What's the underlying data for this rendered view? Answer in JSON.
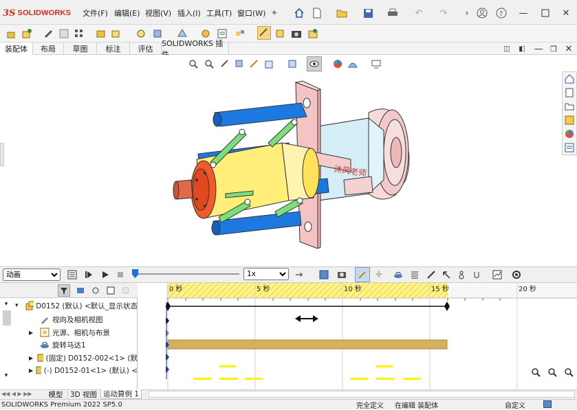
{
  "app": {
    "logo_mark": "3S",
    "logo_text": "SOLIDWORKS"
  },
  "menu": [
    {
      "label": "文件(F)"
    },
    {
      "label": "编辑(E)"
    },
    {
      "label": "视图(V)"
    },
    {
      "label": "插入(I)"
    },
    {
      "label": "工具(T)"
    },
    {
      "label": "窗口(W)"
    }
  ],
  "tabs": [
    {
      "label": "装配体",
      "active": true
    },
    {
      "label": "布局"
    },
    {
      "label": "草图"
    },
    {
      "label": "标注"
    },
    {
      "label": "评估"
    },
    {
      "label": "SOLIDWORKS 插件"
    }
  ],
  "viewport": {
    "watermark": "沐风老师"
  },
  "animation": {
    "study_type": "动画",
    "speed": "1x",
    "time_ticks": [
      "0 秒",
      "5 秒",
      "10 秒",
      "15 秒",
      "20 秒"
    ]
  },
  "tree": [
    {
      "label": "D0152 (默认) <默认_显示状态",
      "icon": "assembly-icon",
      "expand": "collapse"
    },
    {
      "label": "视向及相机视图",
      "icon": "camera-icon",
      "expand": ""
    },
    {
      "label": "光源、相机与布景",
      "icon": "lights-icon",
      "expand": "expand"
    },
    {
      "label": "旋转马达1",
      "icon": "motor-icon",
      "expand": ""
    },
    {
      "label": "(固定) D0152-002<1> (默",
      "icon": "part-icon",
      "expand": "expand"
    },
    {
      "label": "(-) D0152-01<1> (默认) <",
      "icon": "part-icon",
      "expand": "expand"
    }
  ],
  "bottom_tabs": [
    {
      "label": "模型"
    },
    {
      "label": "3D 视图"
    },
    {
      "label": "运动算例 1",
      "active": true
    }
  ],
  "status": {
    "product": "SOLIDWORKS Premium 2022 SP5.0",
    "definition": "完全定义",
    "editing": "在编辑 装配体",
    "custom": "自定义"
  },
  "colors": {
    "accent_red": "#d52b1e",
    "timeline_yellow": "#fff48a",
    "motor_bar": "#d4b060",
    "part_blue": "#1a73e8",
    "part_yellow": "#ffe86a",
    "part_pink": "#f4c8c8"
  }
}
